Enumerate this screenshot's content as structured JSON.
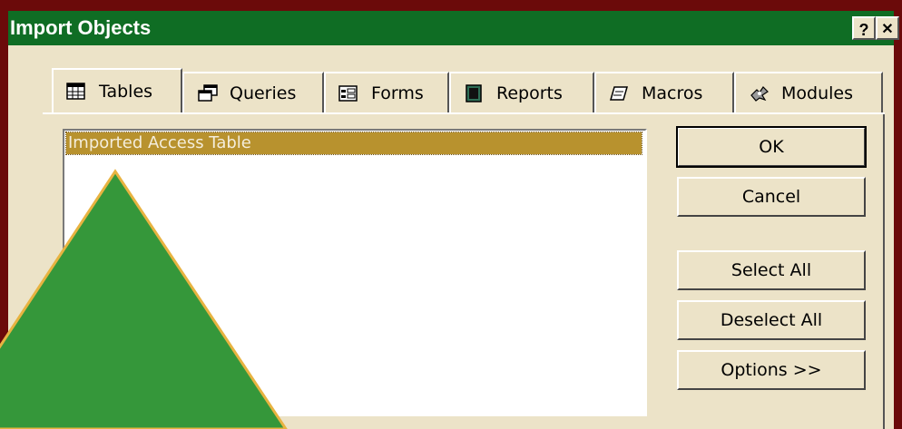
{
  "window": {
    "title": "Import Objects",
    "help_label": "?",
    "close_label": "✕"
  },
  "tabs": [
    {
      "label": "Tables",
      "icon": "table-icon",
      "active": true
    },
    {
      "label": "Queries",
      "icon": "query-icon",
      "active": false
    },
    {
      "label": "Forms",
      "icon": "form-icon",
      "active": false
    },
    {
      "label": "Reports",
      "icon": "report-icon",
      "active": false
    },
    {
      "label": "Macros",
      "icon": "macro-icon",
      "active": false
    },
    {
      "label": "Modules",
      "icon": "module-icon",
      "active": false
    }
  ],
  "list": {
    "items": [
      "Imported Access Table"
    ],
    "selected_index": 0
  },
  "buttons": {
    "ok": "OK",
    "cancel": "Cancel",
    "select_all": "Select All",
    "deselect_all": "Deselect All",
    "options": "Options >>"
  },
  "colors": {
    "title_bar": "#0f6d24",
    "frame": "#6b0a0a",
    "dialog_face": "#ece3c8",
    "selection": "#b8922e",
    "triangle_fill": "#35973a",
    "triangle_outline": "#e8b341"
  }
}
